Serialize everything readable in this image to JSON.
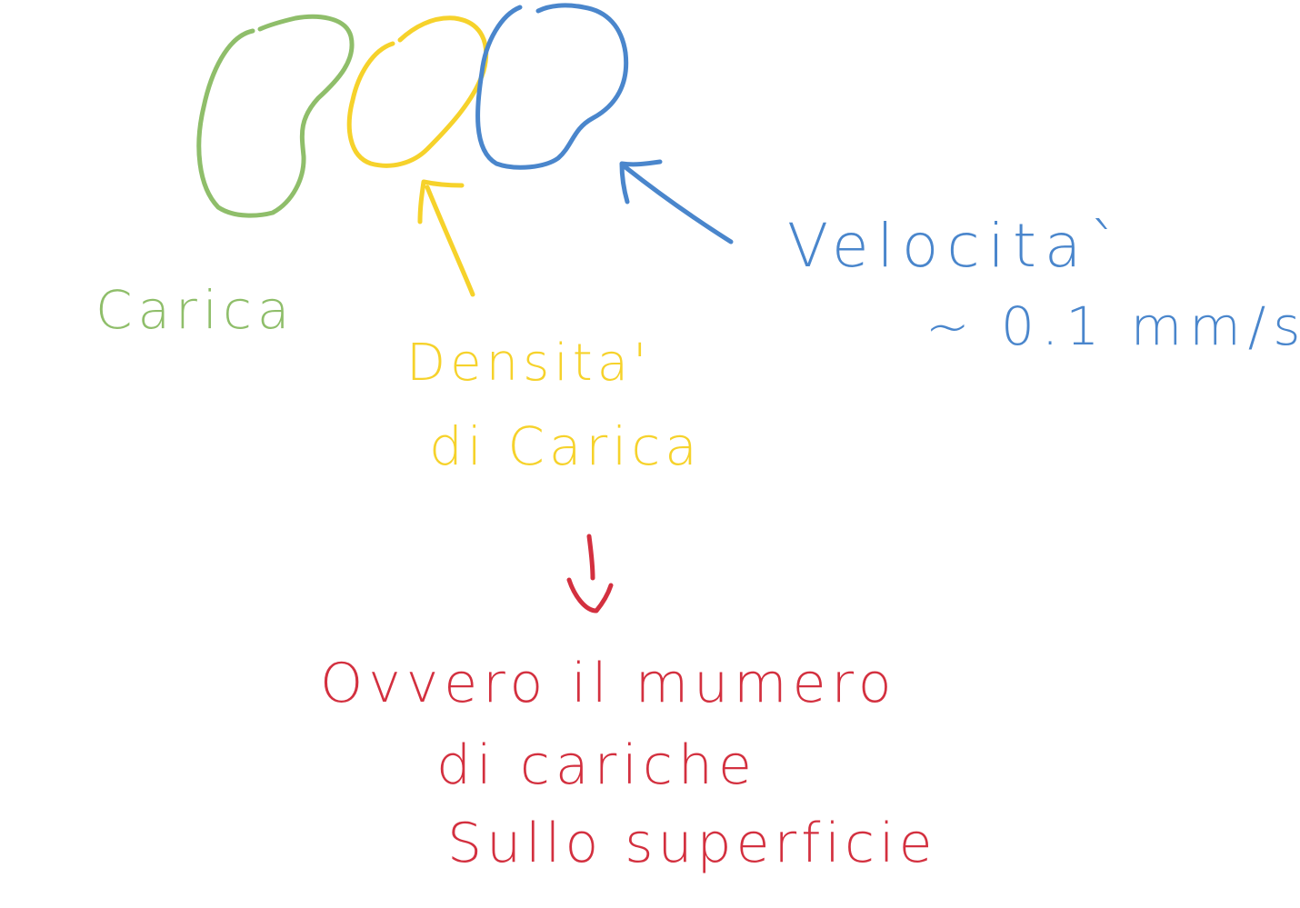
{
  "colors": {
    "green": "#8fbe6a",
    "yellow": "#f6d22b",
    "blue": "#4a86cc",
    "red": "#d3303f",
    "background": "#ffffff"
  },
  "labels": {
    "carica": "Carica",
    "densita_line1": "Densita'",
    "densita_line2": "di Carica",
    "velocita_line1": "Velocita`",
    "velocita_line2": "~ 0.1 mm/s",
    "ovvero_line1": "Ovvero il mumero",
    "ovvero_line2": "di cariche",
    "ovvero_line3": "Sullo superficie"
  }
}
